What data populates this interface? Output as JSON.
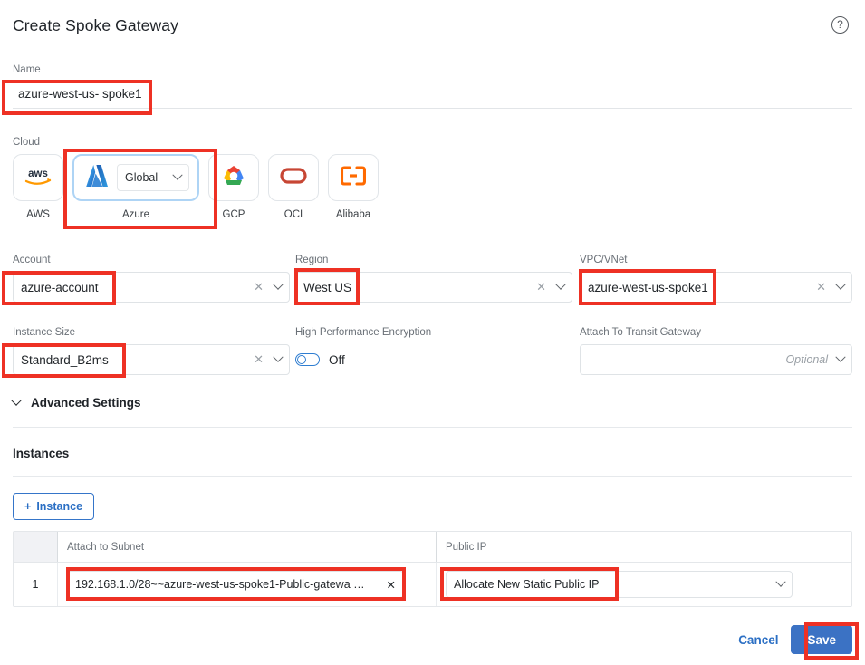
{
  "header": {
    "title": "Create Spoke Gateway",
    "help_icon": "?"
  },
  "name_field": {
    "label": "Name",
    "value": "azure-west-us- spoke1"
  },
  "cloud": {
    "label": "Cloud",
    "selected": "Azure",
    "tiles": [
      {
        "name": "AWS",
        "icon": "aws-icon"
      },
      {
        "name": "Azure",
        "icon": "azure-icon",
        "dropdown_value": "Global"
      },
      {
        "name": "GCP",
        "icon": "gcp-icon"
      },
      {
        "name": "OCI",
        "icon": "oci-icon"
      },
      {
        "name": "Alibaba",
        "icon": "alibaba-icon"
      }
    ]
  },
  "account": {
    "label": "Account",
    "value": "azure-account"
  },
  "region": {
    "label": "Region",
    "value": "West US"
  },
  "vpc": {
    "label": "VPC/VNet",
    "value": "azure-west-us-spoke1"
  },
  "instance_size": {
    "label": "Instance Size",
    "value": "Standard_B2ms"
  },
  "hpe": {
    "label": "High Performance Encryption",
    "state": "Off"
  },
  "transit_gateway": {
    "label": "Attach To Transit Gateway",
    "value": "",
    "placeholder": "Optional"
  },
  "advanced": {
    "label": "Advanced Settings"
  },
  "instances": {
    "title": "Instances",
    "add_button": "Instance",
    "add_button_plus": "+",
    "columns": [
      "",
      "Attach to Subnet",
      "Public IP",
      ""
    ],
    "rows": [
      {
        "num": "1",
        "subnet": "192.168.1.0/28~~azure-west-us-spoke1-Public-gatewa …",
        "public_ip": "Allocate New Static Public IP"
      }
    ]
  },
  "footer": {
    "cancel": "Cancel",
    "save": "Save"
  },
  "colors": {
    "annotation": "#ee3124",
    "primary": "#3b72c4",
    "link": "#2b6fc4"
  }
}
